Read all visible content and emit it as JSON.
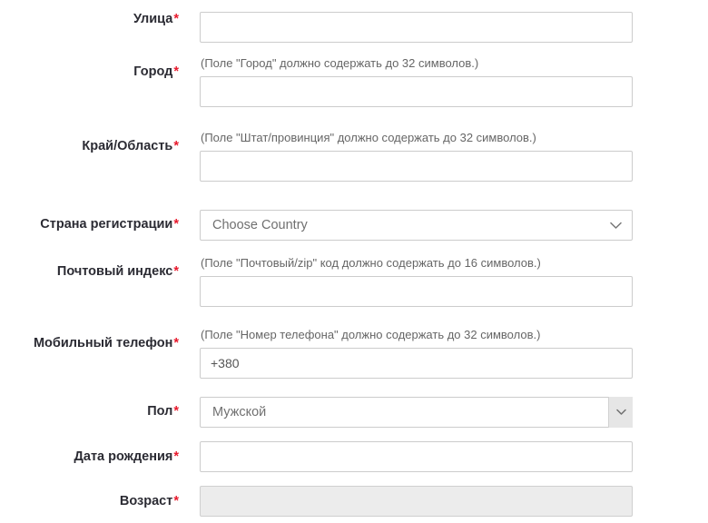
{
  "form": {
    "required_marker": "*",
    "rows": [
      {
        "label": "Улица",
        "required": true,
        "hint": "",
        "control": "text",
        "value": "",
        "placeholder": ""
      },
      {
        "label": "Город",
        "required": true,
        "hint": "(Поле \"Город\" должно содержать до 32 символов.)",
        "control": "text",
        "value": "",
        "placeholder": ""
      },
      {
        "label": "Край/Область",
        "required": true,
        "hint": "(Поле \"Штат/провинция\" должно содержать до 32 символов.)",
        "control": "text",
        "value": "",
        "placeholder": ""
      },
      {
        "label": "Страна регистрации",
        "required": true,
        "hint": "",
        "control": "select-plain",
        "value": "Choose Country"
      },
      {
        "label": "Почтовый индекс",
        "required": true,
        "hint": "(Поле \"Почтовый/zip\" код должно содержать до 16 символов.)",
        "control": "text",
        "value": "",
        "placeholder": ""
      },
      {
        "label": "Мобильный телефон",
        "required": true,
        "hint": "(Поле \"Номер телефона\" должно содержать до 32 символов.)",
        "control": "text",
        "value": "+380",
        "placeholder": ""
      },
      {
        "label": "Пол",
        "required": true,
        "hint": "",
        "control": "select-button",
        "value": "Мужской"
      },
      {
        "label": "Дата рождения",
        "required": true,
        "hint": "",
        "control": "text",
        "value": "",
        "placeholder": ""
      },
      {
        "label": "Возраст",
        "required": true,
        "hint": "",
        "control": "text-disabled",
        "value": "",
        "placeholder": ""
      }
    ]
  },
  "icons": {
    "chevron_down": "chevron-down-icon"
  },
  "colors": {
    "required_asterisk": "#e8192c",
    "label_text": "#2b2b33",
    "hint_text": "#666666",
    "input_border": "#cccccc",
    "input_text": "#555555",
    "placeholder_text": "#9a9a9a",
    "disabled_fill": "#ececec",
    "select_button_fill": "#e6e6e6",
    "page_background": "#ffffff"
  }
}
